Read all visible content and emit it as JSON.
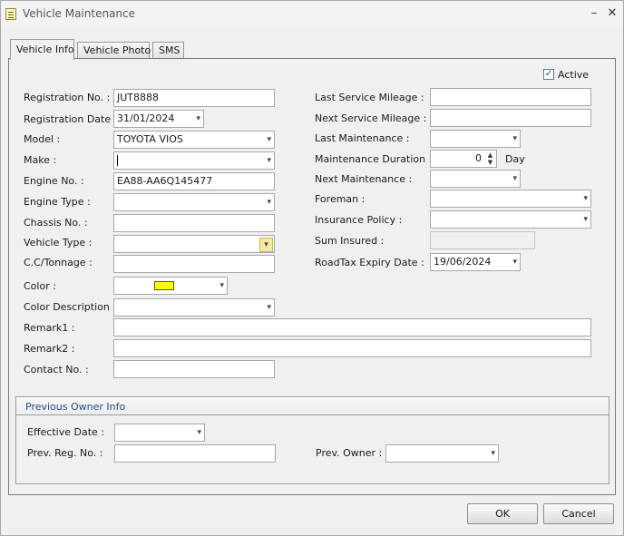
{
  "window": {
    "title": "Vehicle Maintenance",
    "minimize_glyph": "–",
    "close_glyph": "✕"
  },
  "tabs": [
    {
      "label": "Vehicle Info",
      "active": true
    },
    {
      "label": "Vehicle Photo",
      "active": false
    },
    {
      "label": "SMS",
      "active": false
    }
  ],
  "active_checkbox": {
    "label": "Active",
    "checked": true,
    "mark": "✓"
  },
  "left": {
    "registration_no": {
      "label": "Registration No. :",
      "value": "JUT8888"
    },
    "registration_date": {
      "label": "Registration Date :",
      "value": "31/01/2024"
    },
    "model": {
      "label": "Model :",
      "value": "TOYOTA VIOS"
    },
    "make": {
      "label": "Make :",
      "value": ""
    },
    "engine_no": {
      "label": "Engine No. :",
      "value": "EA88-AA6Q145477"
    },
    "engine_type": {
      "label": "Engine Type :",
      "value": ""
    },
    "chassis_no": {
      "label": "Chassis No. :",
      "value": ""
    },
    "vehicle_type": {
      "label": "Vehicle Type :",
      "value": ""
    },
    "cc_tonnage": {
      "label": "C.C/Tonnage :",
      "value": ""
    },
    "color": {
      "label": "Color :",
      "swatch": "#ffff00"
    },
    "color_description": {
      "label": "Color Description :",
      "value": ""
    },
    "remark1": {
      "label": "Remark1 :",
      "value": ""
    },
    "remark2": {
      "label": "Remark2 :",
      "value": ""
    },
    "contact_no": {
      "label": "Contact No. :",
      "value": ""
    }
  },
  "right": {
    "last_service_mileage": {
      "label": "Last Service Mileage :",
      "value": ""
    },
    "next_service_mileage": {
      "label": "Next Service Mileage :",
      "value": ""
    },
    "last_maintenance": {
      "label": "Last Maintenance :",
      "value": ""
    },
    "maintenance_duration": {
      "label": "Maintenance Duration :",
      "value": "0",
      "unit": "Day"
    },
    "next_maintenance": {
      "label": "Next Maintenance :",
      "value": ""
    },
    "foreman": {
      "label": "Foreman :",
      "value": ""
    },
    "insurance_policy": {
      "label": "Insurance Policy :",
      "value": ""
    },
    "sum_insured": {
      "label": "Sum Insured :",
      "value": ""
    },
    "roadtax_expiry_date": {
      "label": "RoadTax Expiry Date :",
      "value": "19/06/2024"
    }
  },
  "previous_owner": {
    "title": "Previous Owner Info",
    "effective_date": {
      "label": "Effective Date :",
      "value": ""
    },
    "prev_reg_no": {
      "label": "Prev. Reg. No. :",
      "value": ""
    },
    "prev_owner": {
      "label": "Prev. Owner :",
      "value": ""
    }
  },
  "buttons": {
    "ok": "OK",
    "cancel": "Cancel"
  },
  "colors": {
    "accent": "#1f4e8c",
    "swatch_yellow": "#ffff00"
  }
}
